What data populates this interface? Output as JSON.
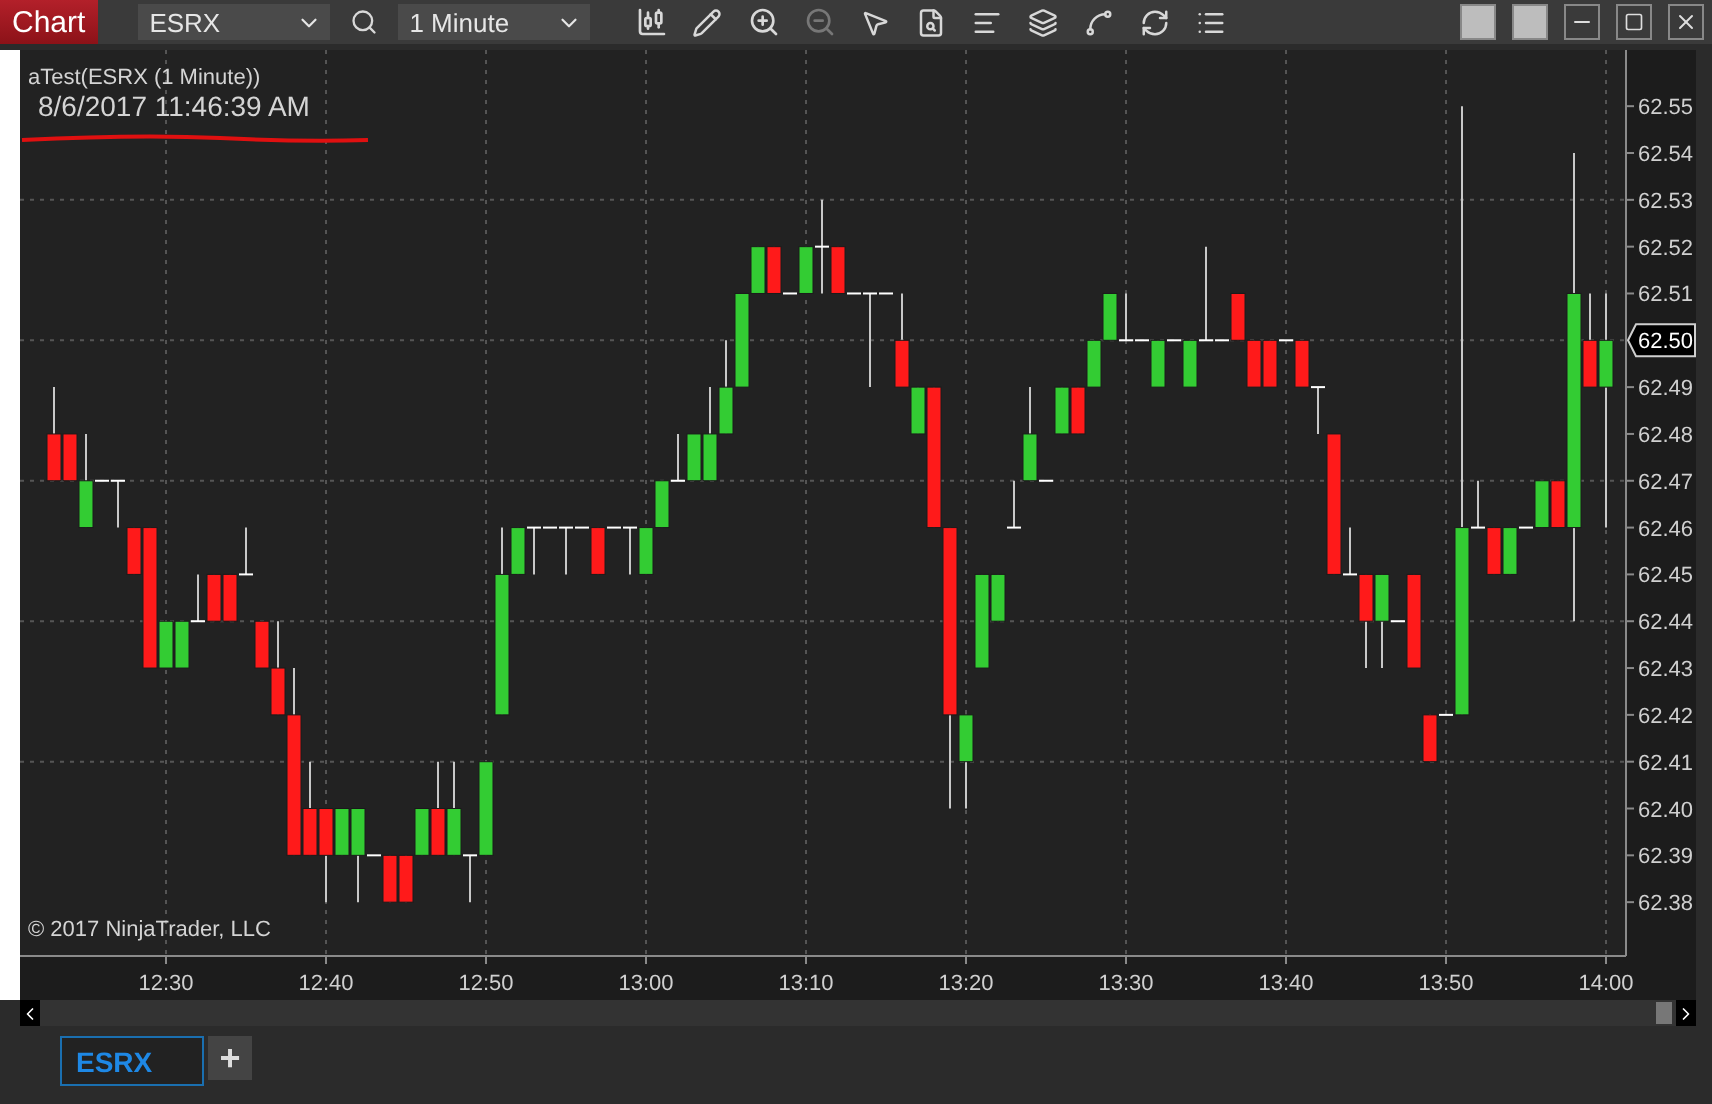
{
  "toolbar": {
    "title": "Chart",
    "instrument": "ESRX",
    "interval": "1 Minute"
  },
  "chart": {
    "indicator_label": "aTest(ESRX (1 Minute))",
    "timestamp": "8/6/2017 11:46:39 AM",
    "copyright": "© 2017 NinjaTrader, LLC",
    "current_price": "62.50",
    "chart_data": {
      "type": "candlestick",
      "ylim": [
        62.3685,
        62.562
      ],
      "yticks": [
        62.38,
        62.39,
        {
          "value": 62.4,
          "label": "62.40"
        },
        62.41,
        62.42,
        62.43,
        62.44,
        62.45,
        62.46,
        62.47,
        62.48,
        62.49,
        62.51,
        62.52,
        62.53,
        62.54,
        62.55
      ],
      "grid": true,
      "categories": [
        null,
        null,
        null,
        null,
        null,
        null,
        null,
        "12:30",
        null,
        null,
        null,
        null,
        null,
        null,
        null,
        null,
        null,
        "12:40",
        null,
        null,
        null,
        null,
        null,
        null,
        null,
        null,
        null,
        "12:50",
        null,
        null,
        null,
        null,
        null,
        null,
        null,
        null,
        null,
        "13:00",
        null,
        null,
        null,
        null,
        null,
        null,
        null,
        null,
        null,
        "13:10",
        null,
        null,
        null,
        null,
        null,
        null,
        null,
        null,
        null,
        "13:20",
        null,
        null,
        null,
        null,
        null,
        null,
        null,
        null,
        null,
        "13:30",
        null,
        null,
        null,
        null,
        null,
        null,
        null,
        null,
        null,
        "13:40",
        null,
        null,
        null,
        null,
        null,
        null,
        null,
        null,
        null,
        "13:50",
        null,
        null,
        null,
        null,
        null,
        null,
        null,
        null,
        null,
        "14:00"
      ],
      "ohlc": [
        [
          62.48,
          62.49,
          62.47,
          62.47
        ],
        [
          62.48,
          62.48,
          62.47,
          62.47
        ],
        [
          62.46,
          62.48,
          62.46,
          62.47
        ],
        [
          62.47,
          62.47,
          62.47,
          62.47
        ],
        [
          62.47,
          62.47,
          62.46,
          62.47
        ],
        [
          62.46,
          62.46,
          62.45,
          62.45
        ],
        [
          62.46,
          62.46,
          62.43,
          62.43
        ],
        [
          62.43,
          62.44,
          62.43,
          62.44
        ],
        [
          62.43,
          62.44,
          62.43,
          62.44
        ],
        [
          62.44,
          62.45,
          62.44,
          62.44
        ],
        [
          62.45,
          62.45,
          62.44,
          62.44
        ],
        [
          62.45,
          62.45,
          62.44,
          62.44
        ],
        [
          62.45,
          62.46,
          62.45,
          62.45
        ],
        [
          62.44,
          62.44,
          62.43,
          62.43
        ],
        [
          62.43,
          62.44,
          62.42,
          62.42
        ],
        [
          62.42,
          62.43,
          62.39,
          62.39
        ],
        [
          62.4,
          62.41,
          62.39,
          62.39
        ],
        [
          62.4,
          62.4,
          62.38,
          62.39
        ],
        [
          62.39,
          62.4,
          62.39,
          62.4
        ],
        [
          62.39,
          62.4,
          62.38,
          62.4
        ],
        [
          62.39,
          62.39,
          62.39,
          62.39
        ],
        [
          62.39,
          62.39,
          62.38,
          62.38
        ],
        [
          62.39,
          62.39,
          62.38,
          62.38
        ],
        [
          62.39,
          62.4,
          62.39,
          62.4
        ],
        [
          62.4,
          62.41,
          62.39,
          62.39
        ],
        [
          62.39,
          62.41,
          62.39,
          62.4
        ],
        [
          62.39,
          62.39,
          62.38,
          62.39
        ],
        [
          62.39,
          62.41,
          62.39,
          62.41
        ],
        [
          62.42,
          62.46,
          62.42,
          62.45
        ],
        [
          62.45,
          62.46,
          62.45,
          62.46
        ],
        [
          62.46,
          62.46,
          62.45,
          62.46
        ],
        [
          62.46,
          62.46,
          62.46,
          62.46
        ],
        [
          62.46,
          62.46,
          62.45,
          62.46
        ],
        [
          62.46,
          62.46,
          62.46,
          62.46
        ],
        [
          62.46,
          62.46,
          62.45,
          62.45
        ],
        [
          62.46,
          62.46,
          62.46,
          62.46
        ],
        [
          62.46,
          62.46,
          62.45,
          62.46
        ],
        [
          62.45,
          62.46,
          62.45,
          62.46
        ],
        [
          62.46,
          62.47,
          62.46,
          62.47
        ],
        [
          62.47,
          62.48,
          62.47,
          62.47
        ],
        [
          62.47,
          62.48,
          62.47,
          62.48
        ],
        [
          62.47,
          62.49,
          62.47,
          62.48
        ],
        [
          62.48,
          62.5,
          62.48,
          62.49
        ],
        [
          62.49,
          62.51,
          62.49,
          62.51
        ],
        [
          62.51,
          62.52,
          62.51,
          62.52
        ],
        [
          62.52,
          62.52,
          62.51,
          62.51
        ],
        [
          62.51,
          62.51,
          62.51,
          62.51
        ],
        [
          62.51,
          62.52,
          62.51,
          62.52
        ],
        [
          62.52,
          62.53,
          62.51,
          62.52
        ],
        [
          62.52,
          62.52,
          62.51,
          62.51
        ],
        [
          62.51,
          62.51,
          62.51,
          62.51
        ],
        [
          62.51,
          62.51,
          62.49,
          62.51
        ],
        [
          62.51,
          62.51,
          62.51,
          62.51
        ],
        [
          62.5,
          62.51,
          62.49,
          62.49
        ],
        [
          62.48,
          62.49,
          62.48,
          62.49
        ],
        [
          62.49,
          62.49,
          62.46,
          62.46
        ],
        [
          62.46,
          62.46,
          62.4,
          62.42
        ],
        [
          62.41,
          62.42,
          62.4,
          62.42
        ],
        [
          62.43,
          62.45,
          62.43,
          62.45
        ],
        [
          62.44,
          62.45,
          62.44,
          62.45
        ],
        [
          62.46,
          62.47,
          62.46,
          62.46
        ],
        [
          62.47,
          62.49,
          62.47,
          62.48
        ],
        [
          62.47,
          62.47,
          62.47,
          62.47
        ],
        [
          62.48,
          62.49,
          62.48,
          62.49
        ],
        [
          62.49,
          62.49,
          62.48,
          62.48
        ],
        [
          62.49,
          62.5,
          62.49,
          62.5
        ],
        [
          62.5,
          62.51,
          62.5,
          62.51
        ],
        [
          62.5,
          62.51,
          62.5,
          62.5
        ],
        [
          62.5,
          62.5,
          62.5,
          62.5
        ],
        [
          62.49,
          62.5,
          62.49,
          62.5
        ],
        [
          62.5,
          62.5,
          62.5,
          62.5
        ],
        [
          62.49,
          62.5,
          62.49,
          62.5
        ],
        [
          62.5,
          62.52,
          62.5,
          62.5
        ],
        [
          62.5,
          62.5,
          62.5,
          62.5
        ],
        [
          62.51,
          62.51,
          62.5,
          62.5
        ],
        [
          62.5,
          62.5,
          62.49,
          62.49
        ],
        [
          62.5,
          62.5,
          62.49,
          62.49
        ],
        [
          62.5,
          62.5,
          62.5,
          62.5
        ],
        [
          62.5,
          62.5,
          62.49,
          62.49
        ],
        [
          62.49,
          62.49,
          62.48,
          62.49
        ],
        [
          62.48,
          62.48,
          62.45,
          62.45
        ],
        [
          62.45,
          62.46,
          62.45,
          62.45
        ],
        [
          62.45,
          62.45,
          62.43,
          62.44
        ],
        [
          62.44,
          62.45,
          62.43,
          62.45
        ],
        [
          62.44,
          62.44,
          62.44,
          62.44
        ],
        [
          62.45,
          62.45,
          62.43,
          62.43
        ],
        [
          62.42,
          62.42,
          62.41,
          62.41
        ],
        [
          62.42,
          62.42,
          62.42,
          62.42
        ],
        [
          62.42,
          62.55,
          62.42,
          62.46
        ],
        [
          62.46,
          62.47,
          62.46,
          62.46
        ],
        [
          62.46,
          62.46,
          62.45,
          62.45
        ],
        [
          62.45,
          62.46,
          62.45,
          62.46
        ],
        [
          62.46,
          62.46,
          62.46,
          62.46
        ],
        [
          62.46,
          62.47,
          62.46,
          62.47
        ],
        [
          62.47,
          62.47,
          62.46,
          62.46
        ],
        [
          62.46,
          62.54,
          62.44,
          62.51
        ],
        [
          62.5,
          62.51,
          62.49,
          62.49
        ],
        [
          62.49,
          62.51,
          62.46,
          62.5
        ]
      ]
    }
  },
  "tabs": [
    {
      "label": "ESRX",
      "selected": true
    }
  ],
  "add_tab": "+"
}
